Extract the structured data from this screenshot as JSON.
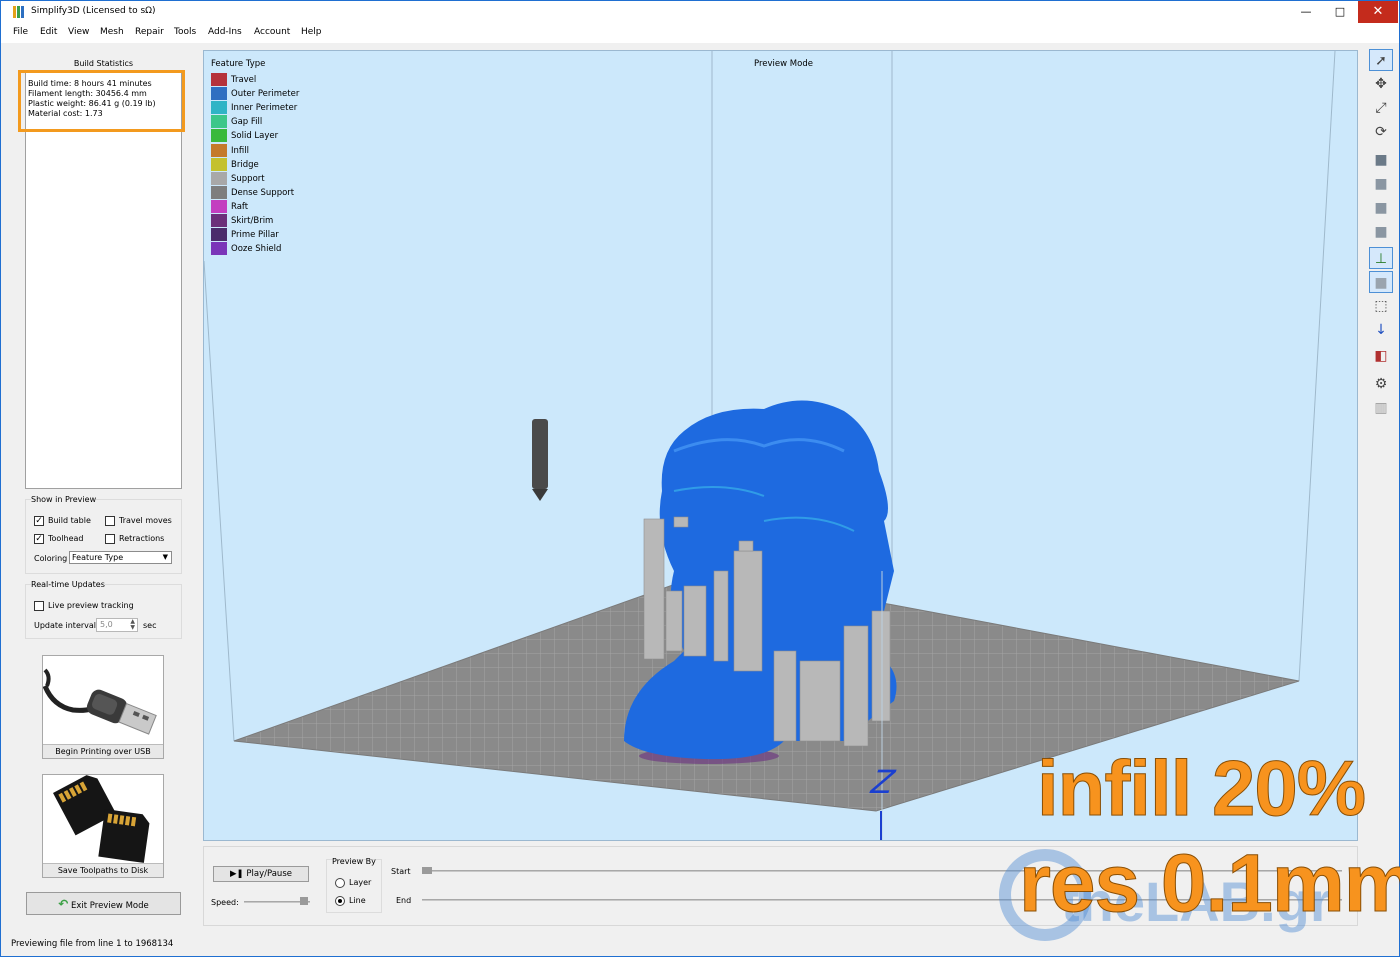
{
  "window": {
    "title": "Simplify3D (Licensed to sΩ)",
    "minimize_glyph": "—",
    "maximize_glyph": "□",
    "close_glyph": "✕"
  },
  "menu": [
    "File",
    "Edit",
    "View",
    "Mesh",
    "Repair",
    "Tools",
    "Add-Ins",
    "Account",
    "Help"
  ],
  "build_statistics": {
    "title": "Build Statistics",
    "lines": [
      "Build time: 8 hours 41 minutes",
      "Filament length: 30456.4 mm",
      "Plastic weight: 86.41 g (0.19 lb)",
      "Material cost: 1.73"
    ]
  },
  "show_in_preview": {
    "title": "Show in Preview",
    "build_table": {
      "label": "Build table",
      "checked": true
    },
    "travel_moves": {
      "label": "Travel moves",
      "checked": false
    },
    "toolhead": {
      "label": "Toolhead",
      "checked": true
    },
    "retractions": {
      "label": "Retractions",
      "checked": false
    },
    "coloring_label": "Coloring",
    "coloring_value": "Feature Type"
  },
  "realtime": {
    "title": "Real-time Updates",
    "live_tracking": {
      "label": "Live preview tracking",
      "checked": false
    },
    "interval_label": "Update interval",
    "interval_value": "5,0",
    "interval_unit": "sec"
  },
  "buttons": {
    "usb": "Begin Printing over USB",
    "save": "Save Toolpaths to Disk",
    "exit": "Exit Preview Mode",
    "play": "Play/Pause"
  },
  "viewport": {
    "legend_title": "Feature Type",
    "mode_label": "Preview Mode",
    "legend": [
      {
        "label": "Travel",
        "color": "#b5323b"
      },
      {
        "label": "Outer Perimeter",
        "color": "#2f6fc1"
      },
      {
        "label": "Inner Perimeter",
        "color": "#2fb4c6"
      },
      {
        "label": "Gap Fill",
        "color": "#3cc78a"
      },
      {
        "label": "Solid Layer",
        "color": "#38b93c"
      },
      {
        "label": "Infill",
        "color": "#c47a2a"
      },
      {
        "label": "Bridge",
        "color": "#c4c12e"
      },
      {
        "label": "Support",
        "color": "#a8a8a8"
      },
      {
        "label": "Dense Support",
        "color": "#7e7e7e"
      },
      {
        "label": "Raft",
        "color": "#c33ec0"
      },
      {
        "label": "Skirt/Brim",
        "color": "#6b2f7a"
      },
      {
        "label": "Prime Pillar",
        "color": "#4a2b6b"
      },
      {
        "label": "Ooze Shield",
        "color": "#7a35b8"
      }
    ],
    "z_axis_label": "Z"
  },
  "preview_controls": {
    "speed_label": "Speed:",
    "preview_by_label": "Preview By",
    "layer_label": "Layer",
    "line_label": "Line",
    "selected": "Line",
    "start_label": "Start",
    "end_label": "End"
  },
  "toolbar_icons": [
    "select-icon",
    "move-icon",
    "scale-icon",
    "rotate-icon",
    "view-iso-icon",
    "view-front-icon",
    "view-top-icon",
    "view-side-icon",
    "axes-icon",
    "solid-view-icon",
    "wireframe-icon",
    "normals-icon",
    "cross-section-icon",
    "settings-icon",
    "supports-icon"
  ],
  "status": {
    "text": "Previewing file from line 1 to 1968134"
  },
  "watermark": {
    "line1": "infill 20%",
    "line2": "res 0.1mm",
    "logo_text": "theLAB.gr"
  }
}
